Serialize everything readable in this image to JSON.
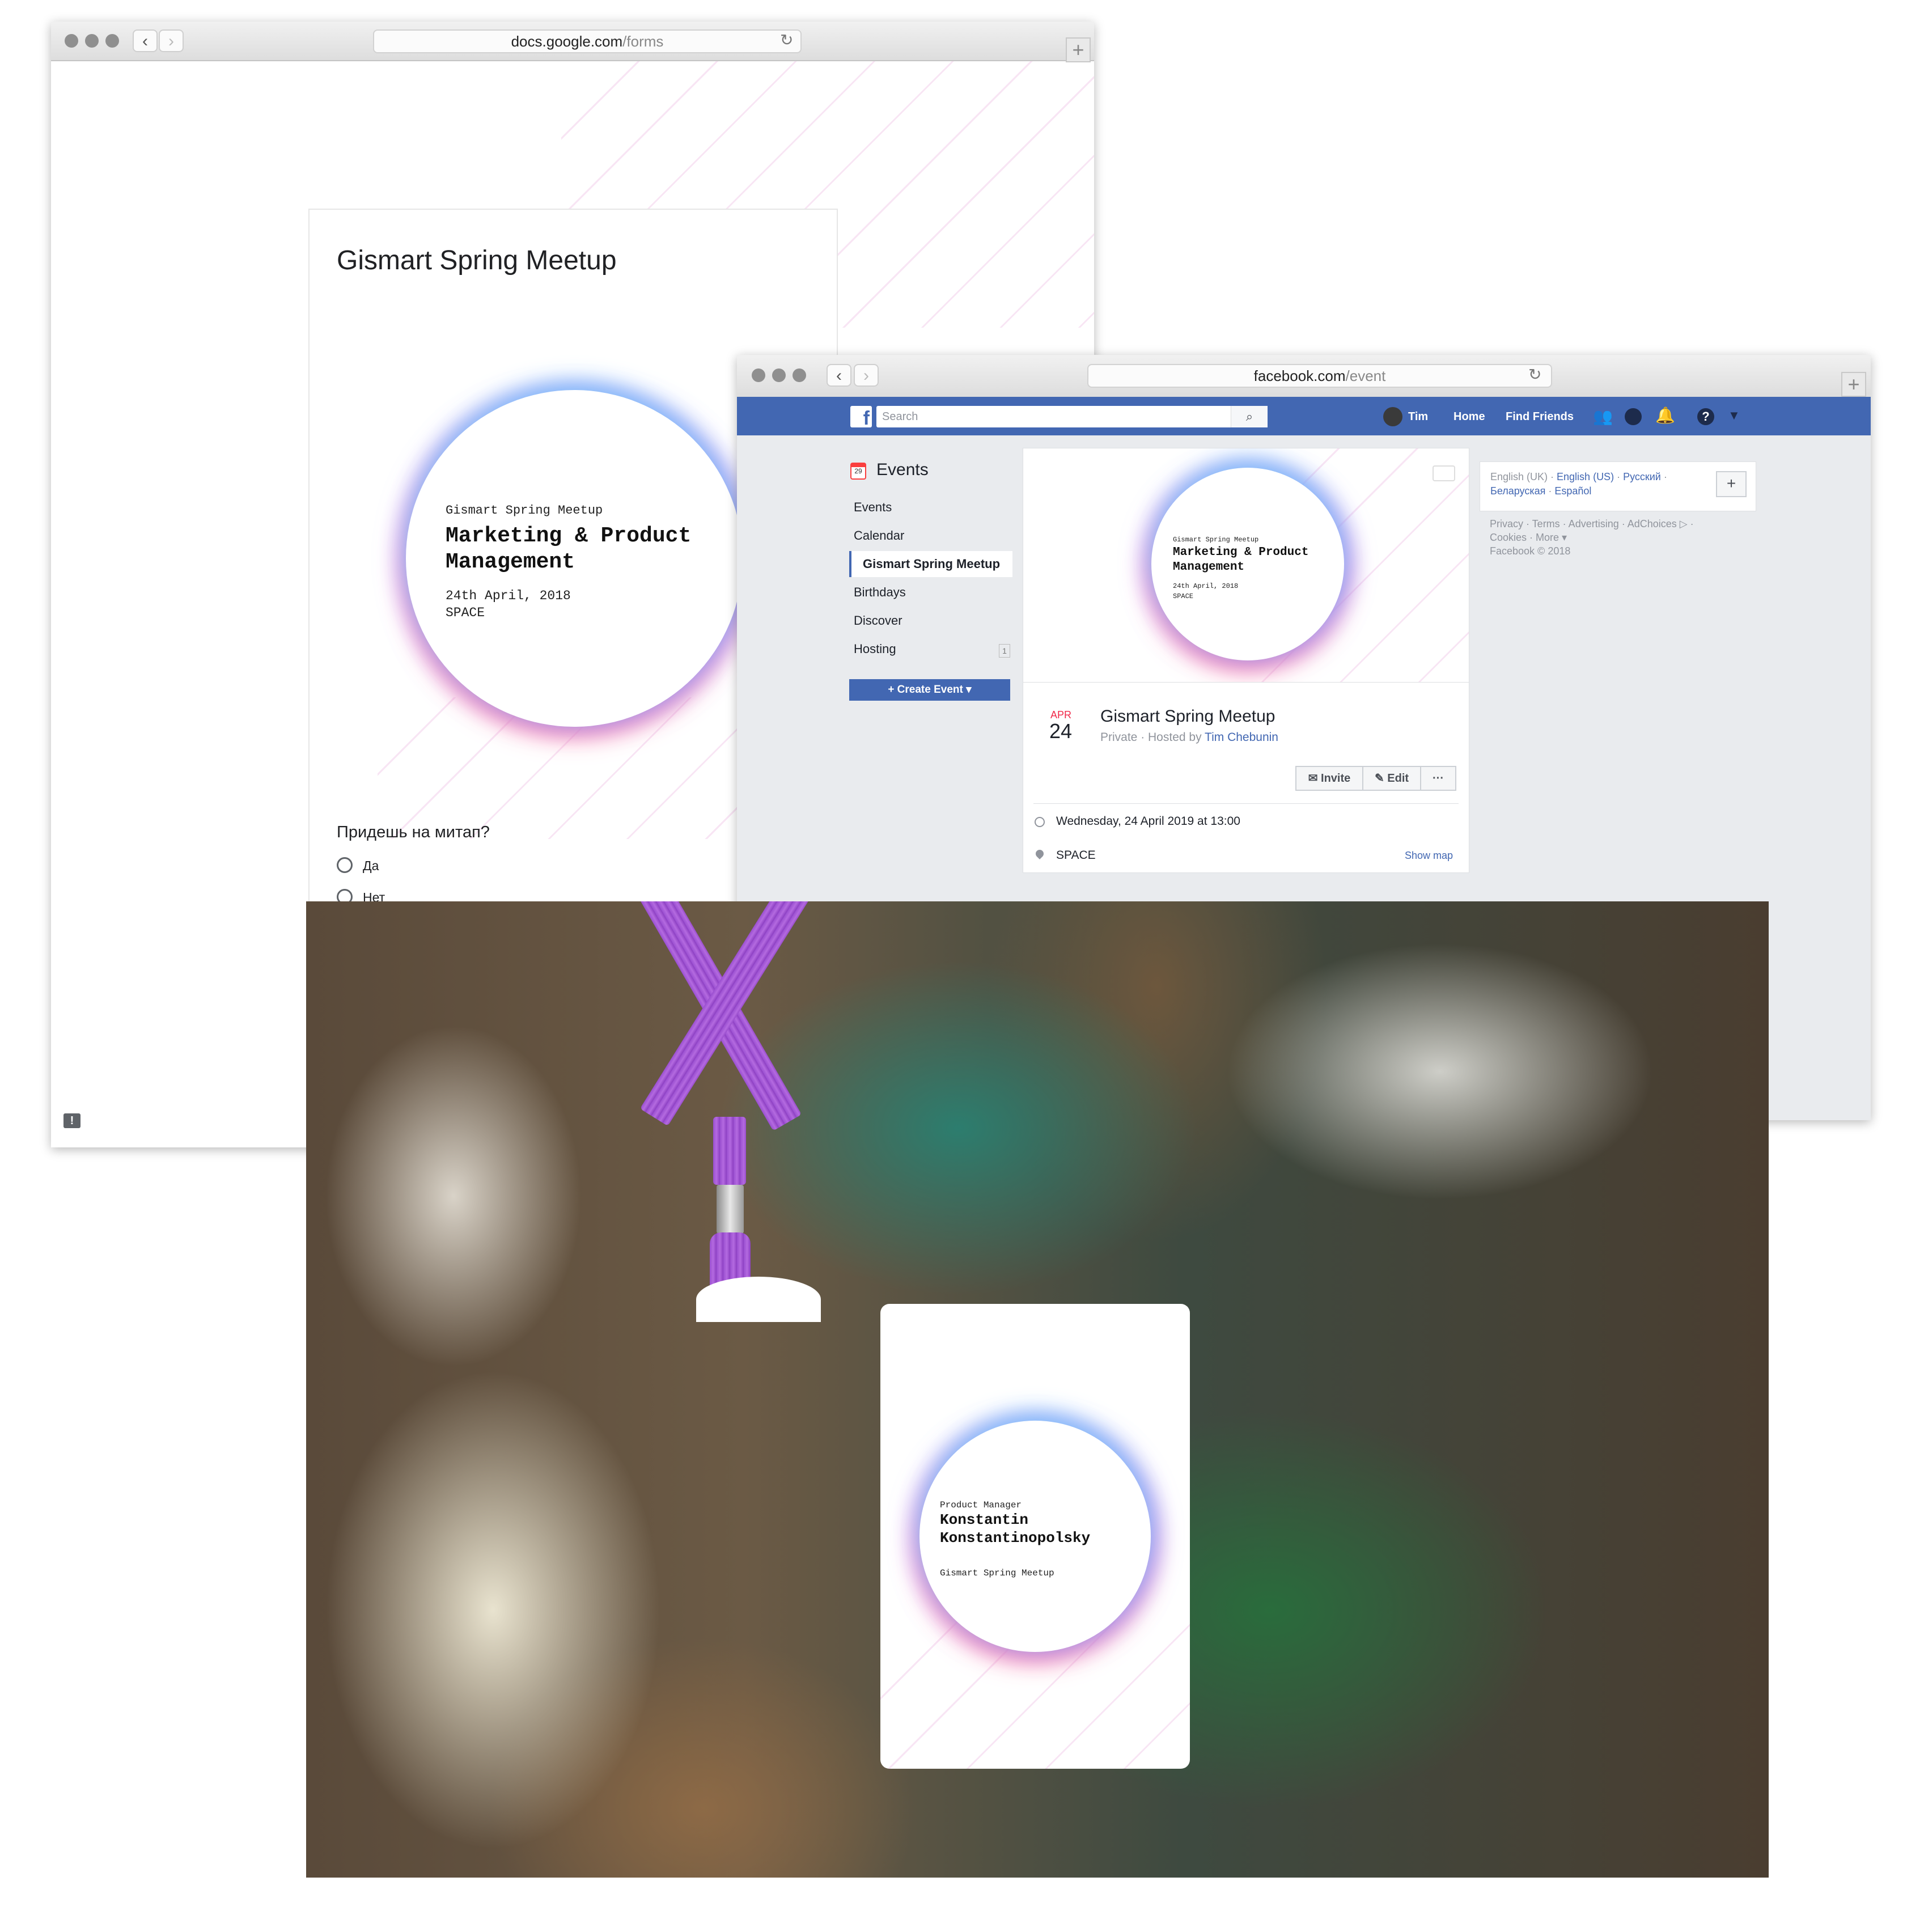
{
  "forms_window": {
    "url_domain": "docs.google.com",
    "url_path": "/forms",
    "form_title": "Gismart Spring Meetup",
    "banner": {
      "overline": "Gismart Spring Meetup",
      "title_line1": "Marketing & Product",
      "title_line2": "Management",
      "date": "24th April, 2018",
      "place": "SPACE"
    },
    "question": "Придешь на митап?",
    "options": [
      "Да",
      "Нет"
    ],
    "feedback_icon": "feedback-icon"
  },
  "facebook_window": {
    "url_domain": "facebook.com",
    "url_path": "/event",
    "nav": {
      "search_placeholder": "Search",
      "user_name": "Tim",
      "home": "Home",
      "find_friends": "Find Friends",
      "brand_color": "#4267b2"
    },
    "sidebar": {
      "title": "Events",
      "calendar_icon_day": "29",
      "items": [
        {
          "label": "Events"
        },
        {
          "label": "Calendar"
        },
        {
          "label": "Gismart Spring Meetup"
        },
        {
          "label": "Birthdays"
        },
        {
          "label": "Discover"
        },
        {
          "label": "Hosting",
          "badge": "1"
        }
      ],
      "create_event": "+ Create Event ▾"
    },
    "event": {
      "cover": {
        "overline": "Gismart Spring Meetup",
        "title_line1": "Marketing & Product",
        "title_line2": "Management",
        "date": "24th April, 2018",
        "place": "SPACE"
      },
      "month": "APR",
      "day": "24",
      "name": "Gismart Spring Meetup",
      "privacy_prefix": "Private · Hosted by ",
      "host": "Tim Chebunin",
      "invite": "Invite",
      "edit": "Edit",
      "more": "···",
      "datetime": "Wednesday, 24 April 2019 at 13:00",
      "location": "SPACE",
      "show_map": "Show map"
    },
    "right_column": {
      "lang_current": "English (UK) · ",
      "lang_links": [
        "English (US)",
        "Русский",
        "Беларуская",
        "Español"
      ],
      "footer_line1": "Privacy · Terms · Advertising · AdChoices ▷ ·",
      "footer_line2": "Cookies · More ▾",
      "copyright": "Facebook © 2018"
    }
  },
  "badge": {
    "role": "Product Manager",
    "name_line1": "Konstantin",
    "name_line2": "Konstantinopolsky",
    "event": "Gismart Spring Meetup",
    "lanyard_color": "#9b4fd3"
  }
}
